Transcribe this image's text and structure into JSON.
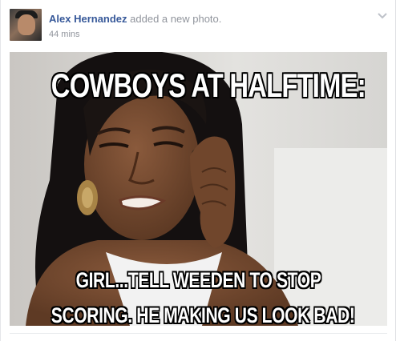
{
  "post": {
    "author": "Alex Hernandez",
    "action": "added a new photo.",
    "timestamp": "44 mins",
    "options_icon": "chevron-down-icon",
    "colors": {
      "author_link": "#365899",
      "meta_text": "#90949c"
    }
  },
  "photo": {
    "top_caption": "COWBOYS AT HALFTIME:",
    "bottom_caption_line1": "GIRL...TELL WEEDEN TO STOP",
    "bottom_caption_line2": "SCORING. HE MAKING US LOOK BAD!"
  }
}
